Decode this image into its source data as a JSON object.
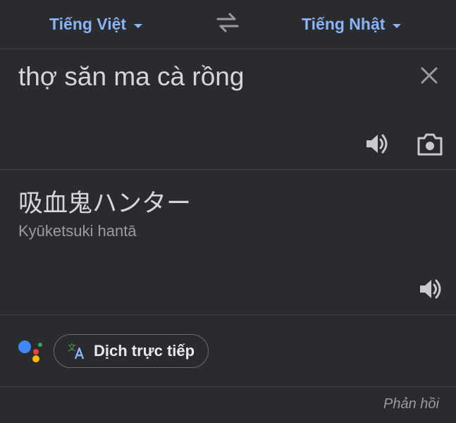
{
  "languages": {
    "source": "Tiếng Việt",
    "target": "Tiếng Nhật"
  },
  "input": {
    "text": "thợ săn ma cà rồng"
  },
  "output": {
    "translation": "吸血鬼ハンター",
    "romanization": "Kyūketsuki hantā"
  },
  "live_translate": {
    "label": "Dịch trực tiếp"
  },
  "feedback": {
    "label": "Phản hồi"
  },
  "icons": {
    "swap": "swap-arrows-icon",
    "close": "close-icon",
    "source_speaker": "speaker-icon",
    "camera": "camera-icon",
    "target_speaker": "speaker-icon",
    "assistant": "google-assistant-icon",
    "translate": "translate-icon"
  },
  "colors": {
    "background": "#2a2b2e",
    "accent": "#8ab4f8",
    "text_primary": "#d5d6d8",
    "text_secondary": "#9b9ca0",
    "divider": "#404144"
  }
}
